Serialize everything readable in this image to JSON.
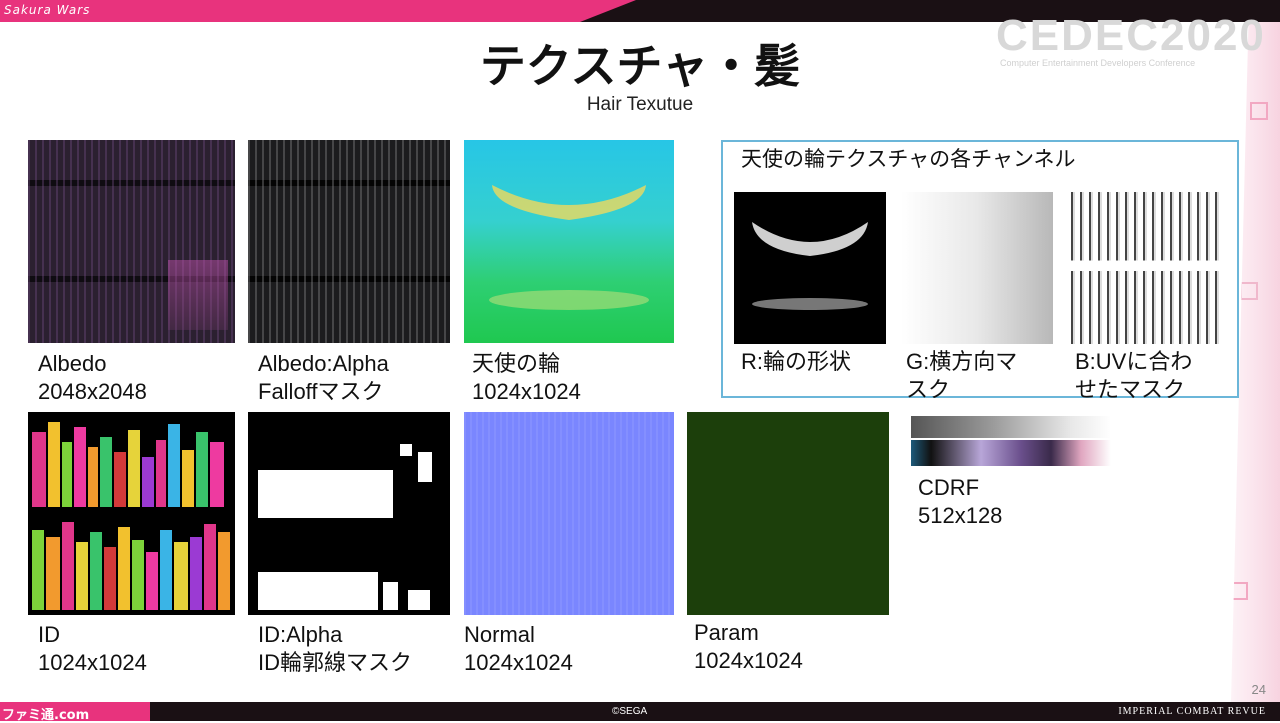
{
  "header": {
    "brand": "Sakura Wars",
    "watermark_main": "CEDEC2020",
    "watermark_sub": "Computer Entertainment Developers Conference"
  },
  "slide": {
    "title": "テクスチャ・髪",
    "subtitle": "Hair Texutue",
    "page_number": "24"
  },
  "textures": [
    {
      "id": "albedo",
      "label": "Albedo\n2048x2048"
    },
    {
      "id": "albedo-alpha",
      "label": "Albedo:Alpha\nFalloffマスク"
    },
    {
      "id": "ring",
      "label": "天使の輪\n1024x1024"
    },
    {
      "id": "id",
      "label": "ID\n1024x1024"
    },
    {
      "id": "id-alpha",
      "label": "ID:Alpha\nID輪郭線マスク"
    },
    {
      "id": "normal",
      "label": "Normal\n1024x1024"
    },
    {
      "id": "param",
      "label": "Param\n1024x1024"
    },
    {
      "id": "cdrf",
      "label": "CDRF\n512x128"
    }
  ],
  "channels": {
    "title": "天使の輪テクスチャの各チャンネル",
    "items": [
      {
        "id": "r",
        "label": "R:輪の形状"
      },
      {
        "id": "g",
        "label": "G:横方向マ\nスク"
      },
      {
        "id": "b",
        "label": "B:UVに合わ\nせたマスク"
      }
    ]
  },
  "footer": {
    "copyright": "©SEGA",
    "game_title": "IMPERIAL COMBAT REVUE",
    "source_logo": "ファミ通.com"
  },
  "colors": {
    "accent_pink": "#e8337d",
    "bar_dark": "#1a1014",
    "channel_border": "#6bb6d9",
    "arrow_blue": "#4a8fd0"
  }
}
